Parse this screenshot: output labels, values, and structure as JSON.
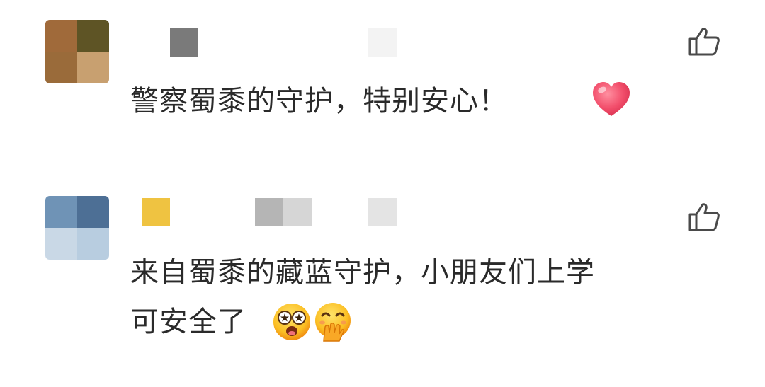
{
  "comments": [
    {
      "text": "警察蜀黍的守护，特别安心！",
      "emoji": [
        "red-heart"
      ],
      "avatar_colors": [
        "#a06a3a",
        "#6b5a2a",
        "#9a6b3a",
        "#c8a070"
      ],
      "name_block_colors": [
        "#7a7a7a",
        "#f0f0f0"
      ]
    },
    {
      "text_line1": "来自蜀黍的藏蓝守护，小朋友们上学",
      "text_line2": "可安全了",
      "emoji": [
        "star-struck-face",
        "hand-over-mouth-face"
      ],
      "avatar_colors": [
        "#6f93b6",
        "#4d6f95",
        "#c9d8e6",
        "#b8cde0"
      ],
      "name_block_colors": [
        "#efc341",
        "#b5b5b5",
        "#d6d6d6",
        "#e6e6e6"
      ]
    }
  ],
  "icons": {
    "like": "thumbs-up-outline-icon"
  }
}
